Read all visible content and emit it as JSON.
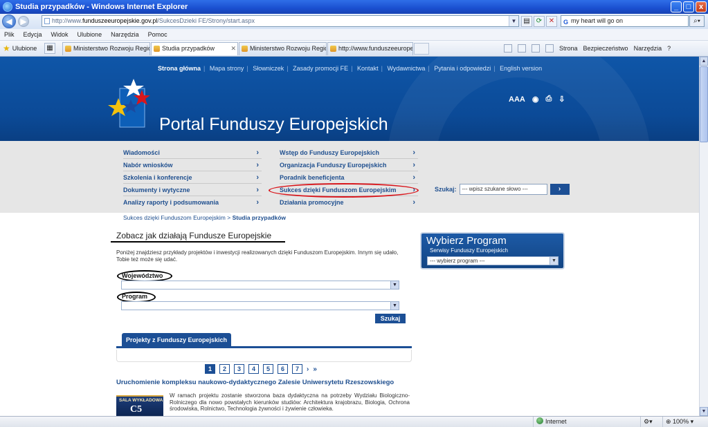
{
  "window": {
    "title": "Studia przypadków - Windows Internet Explorer",
    "minimize": "_",
    "maximize": "□",
    "close": "x"
  },
  "address": {
    "url_prefix": "http://www.",
    "url_host": "funduszeeuropejskie.gov.pl",
    "url_path": "/SukcesDzieki FE/Strony/start.aspx",
    "search_value": "my heart will go on",
    "search_engine": "G"
  },
  "menu": [
    "Plik",
    "Edycja",
    "Widok",
    "Ulubione",
    "Narzędzia",
    "Pomoc"
  ],
  "favorites_label": "Ulubione",
  "tabs": [
    {
      "label": "Ministerstwo Rozwoju Region..."
    },
    {
      "label": "Studia przypadków"
    },
    {
      "label": "Ministerstwo Rozwoju Region..."
    },
    {
      "label": "http://www.funduszeeurope..."
    }
  ],
  "command_bar": {
    "page": "Strona",
    "safety": "Bezpieczeństwo",
    "tools": "Narzędzia",
    "help": "?"
  },
  "site": {
    "top_links": [
      "Strona główna",
      "Mapa strony",
      "Słowniczek",
      "Zasady promocji FE",
      "Kontakt",
      "Wydawnictwa",
      "Pytania i odpowiedzi",
      "English version"
    ],
    "title": "Portal Funduszy Europejskich",
    "tools": {
      "font_size": "AAA"
    },
    "nav_left": [
      "Wiadomości",
      "Nabór wniosków",
      "Szkolenia i konferencje",
      "Dokumenty i wytyczne",
      "Analizy raporty i podsumowania"
    ],
    "nav_right": [
      "Wstęp do Funduszy Europejskich",
      "Organizacja Funduszy Europejskich",
      "Poradnik beneficjenta",
      "Sukces dzięki Funduszom Europejskim",
      "Działania promocyjne"
    ],
    "search_label": "Szukaj:",
    "search_placeholder": "--- wpisz szukane słowo ---",
    "search_go": "›",
    "breadcrumb": {
      "parent": "Sukces dzięki Funduszom Europejskim",
      "sep": ">",
      "current": "Studia przypadków"
    }
  },
  "main": {
    "heading": "Zobacz jak działają Fundusze Europejskie",
    "intro": "Poniżej znajdziesz przykłady projektów i inwestycji realizowanych dzięki Funduszom Europejskim. Innym się udało, Tobie też może się udać.",
    "field_region": "Województwo",
    "field_program": "Program",
    "search_button": "Szukaj",
    "tab_projects": "Projekty z Funduszy Europejskich",
    "pages": [
      "1",
      "2",
      "3",
      "4",
      "5",
      "6",
      "7"
    ],
    "next": "›",
    "last": "»",
    "article_title": "Uruchomienie kompleksu naukowo-dydaktycznego Zalesie Uniwersytetu Rzeszowskiego",
    "article_text": "W ramach projektu zostanie stworzona baza dydaktyczna na potrzeby Wydziału Biologiczno-Rolniczego dla nowo powstałych kierunków studiów: Architektura krajobrazu, Biologia, Ochrona środowiska, Rolnictwo, Technologia żywności i żywienie człowieka.",
    "thumb_caption": "SALA WYKŁADOWA",
    "thumb_code": "C5"
  },
  "program_box": {
    "title": "Wybierz Program",
    "subtitle": "Serwisy Funduszy Europejskich",
    "select_value": "--- wybierz program ---"
  },
  "status": {
    "zone": "Internet",
    "zoom": "100%"
  }
}
